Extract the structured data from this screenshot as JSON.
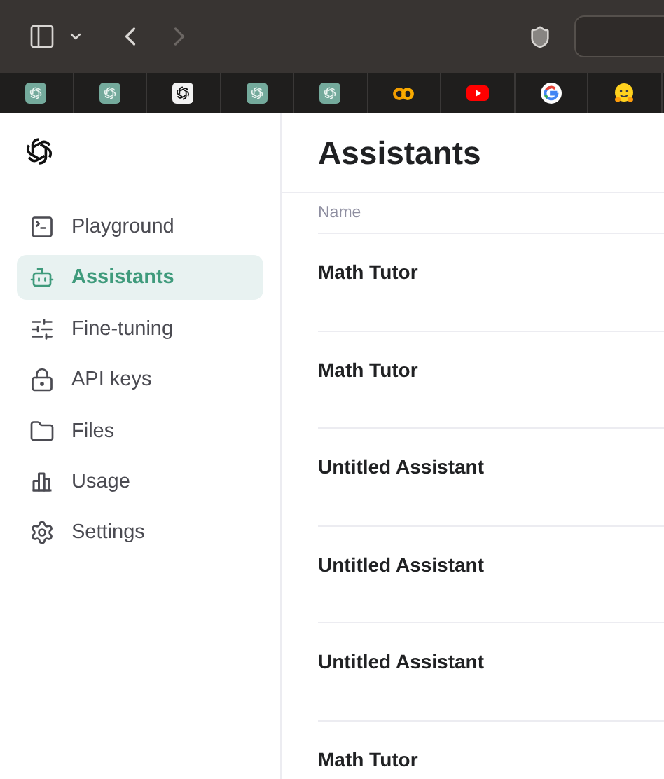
{
  "browser": {
    "back_disabled": false,
    "forward_disabled": true,
    "tabs": [
      {
        "kind": "openai",
        "selected": false
      },
      {
        "kind": "openai",
        "selected": false
      },
      {
        "kind": "openai-dark",
        "selected": false
      },
      {
        "kind": "openai",
        "selected": false
      },
      {
        "kind": "openai",
        "selected": false
      },
      {
        "kind": "colab",
        "selected": false
      },
      {
        "kind": "youtube",
        "selected": false
      },
      {
        "kind": "google",
        "selected": false
      },
      {
        "kind": "huggingface",
        "selected": false
      }
    ]
  },
  "sidebar": {
    "items": [
      {
        "label": "Playground",
        "kind": "terminal",
        "selected": false
      },
      {
        "label": "Assistants",
        "kind": "bot",
        "selected": true
      },
      {
        "label": "Fine-tuning",
        "kind": "sliders",
        "selected": false
      },
      {
        "label": "API keys",
        "kind": "lock",
        "selected": false
      },
      {
        "label": "Files",
        "kind": "folder",
        "selected": false
      },
      {
        "label": "Usage",
        "kind": "chart",
        "selected": false
      },
      {
        "label": "Settings",
        "kind": "gear",
        "selected": false
      }
    ]
  },
  "page": {
    "title": "Assistants",
    "columns": [
      "Name"
    ],
    "rows": [
      {
        "name": "Math Tutor"
      },
      {
        "name": "Math Tutor"
      },
      {
        "name": "Untitled Assistant"
      },
      {
        "name": "Untitled Assistant"
      },
      {
        "name": "Untitled Assistant"
      },
      {
        "name": "Math Tutor"
      }
    ]
  }
}
